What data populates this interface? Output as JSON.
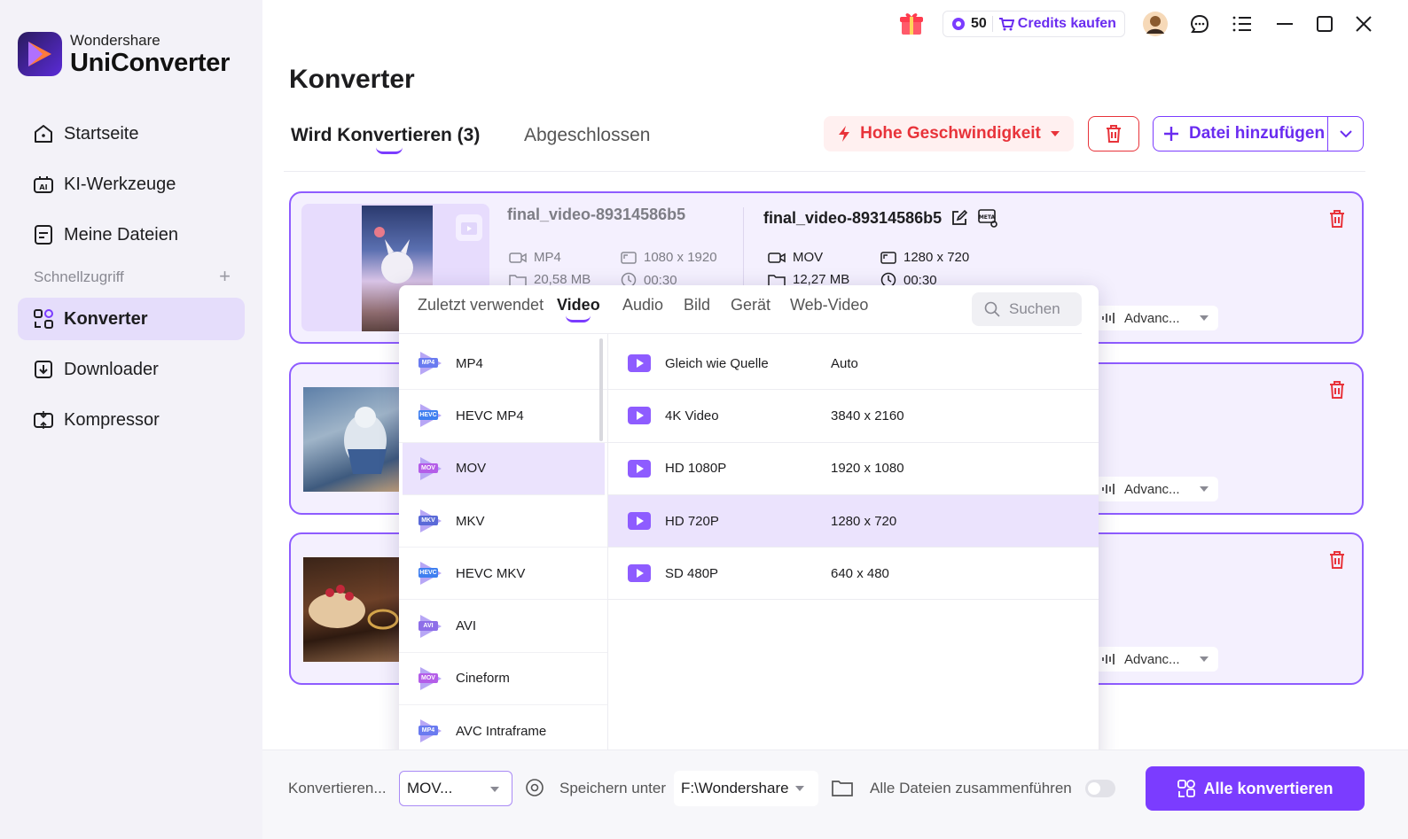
{
  "app": {
    "brand_small": "Wondershare",
    "brand_big": "UniConverter",
    "accent": "#7B3CFF",
    "danger": "#E8333A"
  },
  "titlebar": {
    "credits_count": "50",
    "buy_credits": "Credits kaufen"
  },
  "sidebar": {
    "items": [
      {
        "label": "Startseite",
        "icon": "home-icon"
      },
      {
        "label": "KI-Werkzeuge",
        "icon": "ai-tools-icon"
      },
      {
        "label": "Meine Dateien",
        "icon": "files-icon"
      },
      {
        "label": "Konverter",
        "icon": "converter-icon",
        "active": true
      },
      {
        "label": "Downloader",
        "icon": "downloader-icon"
      },
      {
        "label": "Kompressor",
        "icon": "compressor-icon"
      }
    ],
    "quick_access": "Schnellzugriff"
  },
  "main": {
    "title": "Konverter",
    "tab_converting": "Wird Konvertieren (3)",
    "tab_done": "Abgeschlossen",
    "speed_button": "Hohe Geschwindigkeit",
    "add_file": "Datei hinzufügen"
  },
  "card1": {
    "src_name": "final_video-89314586b5",
    "src_format": "MP4",
    "src_resolution": "1080 x 1920",
    "src_size": "20,58 MB",
    "src_duration": "00:30",
    "dst_name": "final_video-89314586b5",
    "dst_format": "MOV",
    "dst_resolution": "1280 x 720",
    "dst_size": "12,27 MB",
    "dst_duration": "00:30",
    "advanced": "Advanc..."
  },
  "card2": {
    "advanced": "Advanc..."
  },
  "card3": {
    "advanced": "Advanc..."
  },
  "format_panel": {
    "tabs": [
      "Zuletzt verwendet",
      "Video",
      "Audio",
      "Bild",
      "Gerät",
      "Web-Video"
    ],
    "search_placeholder": "Suchen",
    "formats": [
      {
        "name": "MP4",
        "badge": "MP4"
      },
      {
        "name": "HEVC MP4",
        "badge": "HEVC"
      },
      {
        "name": "MOV",
        "badge": "MOV",
        "selected": true
      },
      {
        "name": "MKV",
        "badge": "MKV"
      },
      {
        "name": "HEVC MKV",
        "badge": "HEVC"
      },
      {
        "name": "AVI",
        "badge": "AVI"
      },
      {
        "name": "Cineform",
        "badge": "MOV"
      },
      {
        "name": "AVC Intraframe",
        "badge": "MP4"
      }
    ],
    "resolutions": [
      {
        "name": "Gleich wie Quelle",
        "value": "Auto"
      },
      {
        "name": "4K Video",
        "value": "3840 x 2160"
      },
      {
        "name": "HD 1080P",
        "value": "1920 x 1080"
      },
      {
        "name": "HD 720P",
        "value": "1280 x 720",
        "selected": true
      },
      {
        "name": "SD 480P",
        "value": "640 x 480"
      }
    ]
  },
  "bottom": {
    "convert_label": "Konvertieren...",
    "convert_value": "MOV...",
    "save_label": "Speichern unter",
    "save_path": "F:\\Wondershare",
    "merge_label": "Alle Dateien zusammenführen",
    "convert_all": "Alle konvertieren"
  }
}
